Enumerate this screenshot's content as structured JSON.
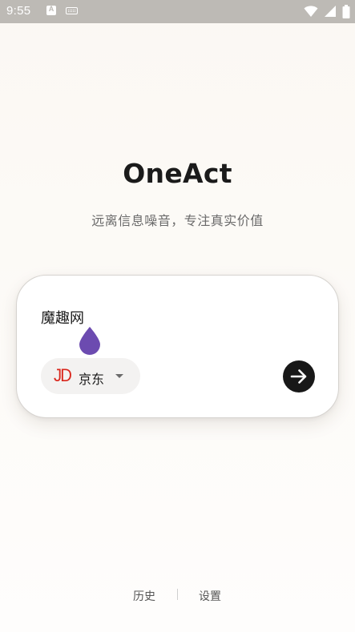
{
  "status_bar": {
    "time": "9:55",
    "notification_icon_text": "A",
    "icons": [
      "a-notification-icon",
      "keyboard-icon",
      "wifi-icon",
      "cellular-signal-icon",
      "battery-icon"
    ]
  },
  "app": {
    "title": "OneAct",
    "subtitle": "远离信息噪音，专注真实价值"
  },
  "search_card": {
    "query_value": "魔趣网",
    "platform": {
      "logo_text": "JD",
      "name": "京东"
    },
    "submit_icon": "arrow-right-icon"
  },
  "bottom_nav": {
    "history_label": "历史",
    "settings_label": "设置"
  },
  "colors": {
    "background": "#fbf8f3",
    "status_bar": "#bdbab5",
    "title": "#1b1b1b",
    "subtitle": "#6a6a6a",
    "card": "#ffffff",
    "chip": "#f3f2f1",
    "jd_red": "#d9261c",
    "submit_button": "#181818",
    "cursor_handle": "#6c4bb0"
  }
}
